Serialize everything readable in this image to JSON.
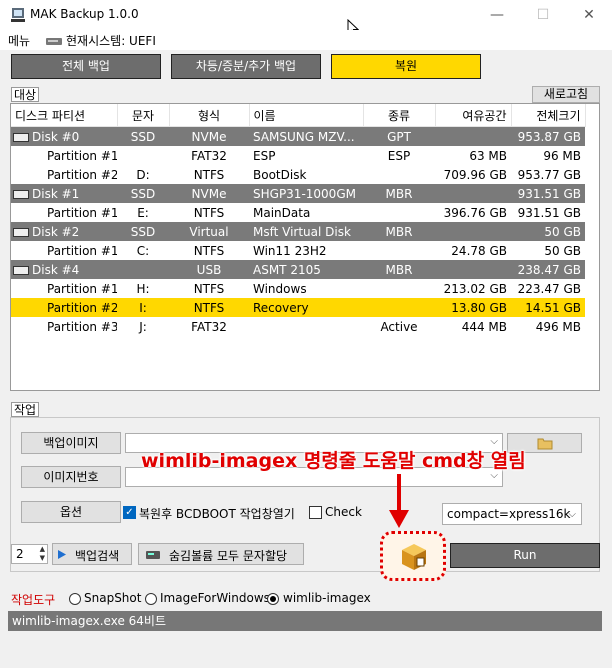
{
  "window": {
    "title": "MAK Backup 1.0.0",
    "minimize": "—",
    "maximize": "☐",
    "close": "✕"
  },
  "menu": {
    "menu_label": "메뉴",
    "system_label": "현재시스템: UEFI"
  },
  "tabs": [
    "전체 백업",
    "차등/증분/추가 백업",
    "복원"
  ],
  "target": {
    "label": "대상",
    "refresh_label": "새로고침"
  },
  "table": {
    "columns": [
      "디스크 파티션",
      "문자",
      "형식",
      "이름",
      "종류",
      "여유공간",
      "전체크기"
    ],
    "rows": [
      {
        "type": "disk",
        "cells": [
          "Disk #0",
          "SSD",
          "NVMe",
          "SAMSUNG MZV...",
          "GPT",
          "",
          "953.87 GB"
        ]
      },
      {
        "type": "part",
        "cells": [
          "Partition #1",
          "",
          "FAT32",
          "ESP",
          "ESP",
          "63 MB",
          "96 MB"
        ]
      },
      {
        "type": "part",
        "cells": [
          "Partition #2",
          "D:",
          "NTFS",
          "BootDisk",
          "",
          "709.96 GB",
          "953.77 GB"
        ]
      },
      {
        "type": "disk",
        "cells": [
          "Disk #1",
          "SSD",
          "NVMe",
          "SHGP31-1000GM",
          "MBR",
          "",
          "931.51 GB"
        ]
      },
      {
        "type": "part",
        "cells": [
          "Partition #1",
          "E:",
          "NTFS",
          "MainData",
          "",
          "396.76 GB",
          "931.51 GB"
        ]
      },
      {
        "type": "disk",
        "cells": [
          "Disk #2",
          "SSD",
          "Virtual",
          "Msft Virtual Disk",
          "MBR",
          "",
          "50 GB"
        ]
      },
      {
        "type": "part",
        "cells": [
          "Partition #1",
          "C:",
          "NTFS",
          "Win11 23H2",
          "",
          "24.78 GB",
          "50 GB"
        ]
      },
      {
        "type": "disk",
        "cells": [
          "Disk #4",
          "",
          "USB",
          "ASMT 2105",
          "MBR",
          "",
          "238.47 GB"
        ]
      },
      {
        "type": "part",
        "cells": [
          "Partition #1",
          "H:",
          "NTFS",
          "Windows",
          "",
          "213.02 GB",
          "223.47 GB"
        ]
      },
      {
        "type": "sel",
        "cells": [
          "Partition #2",
          "I:",
          "NTFS",
          "Recovery",
          "",
          "13.80 GB",
          "14.51 GB"
        ]
      },
      {
        "type": "part",
        "cells": [
          "Partition #3",
          "J:",
          "FAT32",
          "",
          "Active",
          "444 MB",
          "496 MB"
        ]
      }
    ]
  },
  "work": {
    "label": "작업",
    "backup_image_label": "백업이미지",
    "image_number_label": "이미지번호",
    "options_label": "옵션",
    "bcdboot_label": "복원후 BCDBOOT 작업창열기",
    "check_label": "Check",
    "compact_value": "compact=xpress16k",
    "spin_value": "2",
    "backup_search_label": "백업검색",
    "hidden_volume_label": "숨김볼륨 모두 문자할당",
    "run_label": "Run",
    "annotation": "wimlib-imagex 명령줄 도움말 cmd창 열림"
  },
  "tools": {
    "label": "작업도구",
    "options": [
      "SnapShot",
      "ImageForWindows",
      "wimlib-imagex"
    ],
    "selected": "wimlib-imagex"
  },
  "status": {
    "text": "wimlib-imagex.exe 64비트"
  },
  "colors": {
    "accent_yellow": "#ffd800",
    "disk_row": "#7a7a7a",
    "annotation_red": "#e00000"
  }
}
